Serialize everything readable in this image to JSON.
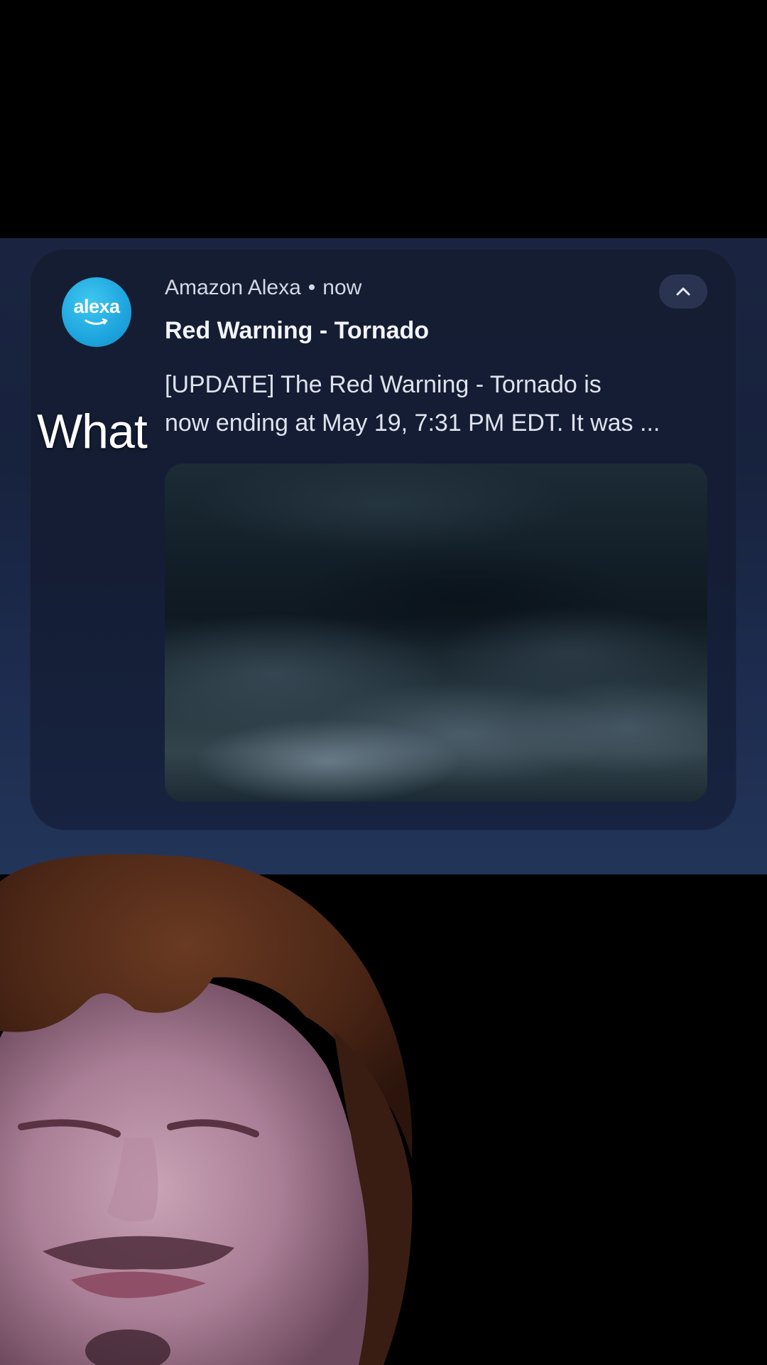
{
  "notification": {
    "app_name": "Amazon Alexa",
    "separator": "•",
    "time": "now",
    "title": "Red Warning - Tornado",
    "body_lines": [
      "[UPDATE] The Red Warning - Tornado is",
      "now ending at May 19, 7:31 PM EDT. It was ..."
    ],
    "app_icon_word": "alexa",
    "app_icon_name": "alexa-logo-icon",
    "collapse_icon": "chevron-up-icon",
    "image_description_icon": "storm-clouds-image"
  },
  "overlay": {
    "caption": "What"
  },
  "colors": {
    "alexa_blue": "#1ea5dd",
    "card_bg": "#151d33",
    "shade_bg": "#1a2440"
  }
}
